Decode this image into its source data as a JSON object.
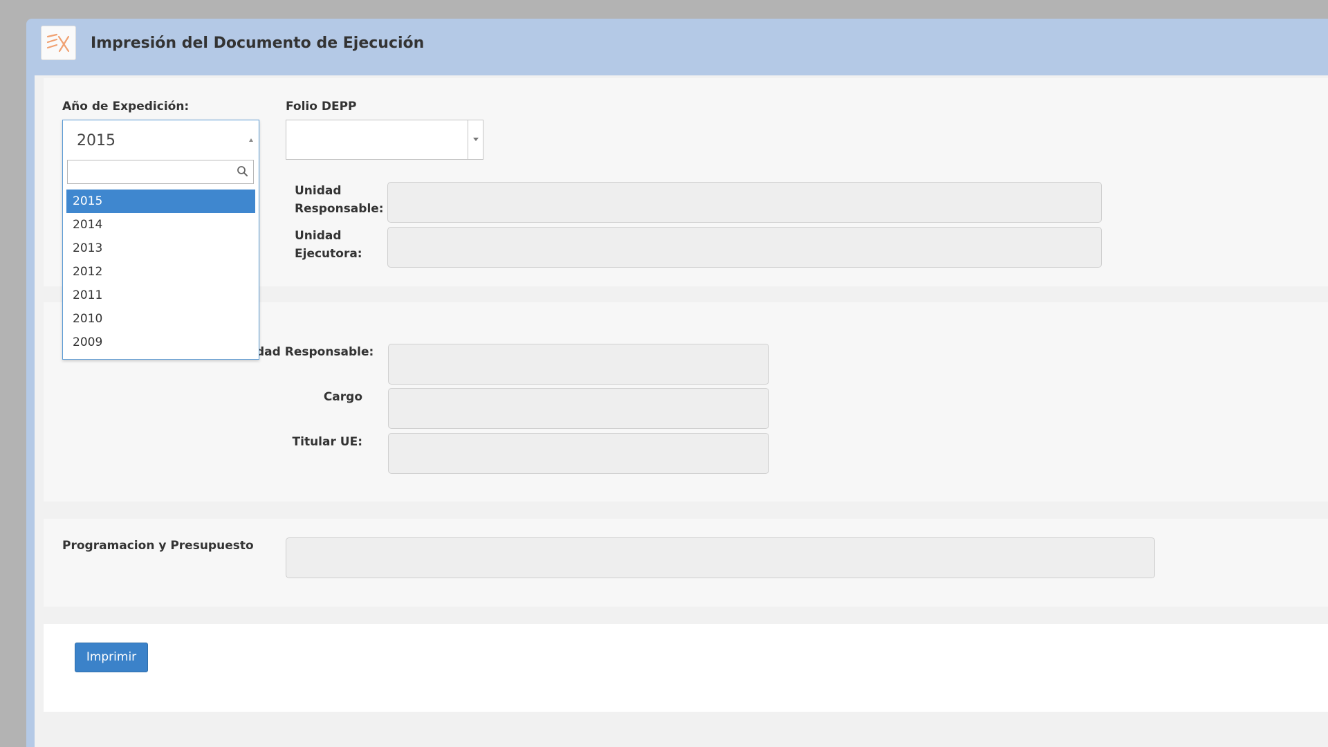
{
  "header": {
    "title": "Impresión del Documento de Ejecución",
    "logo_icon": "ex-logo-icon"
  },
  "form": {
    "anio_label": "Año de Expedición:",
    "anio_selected": "2015",
    "anio_options": [
      "2015",
      "2014",
      "2013",
      "2012",
      "2011",
      "2010",
      "2009"
    ],
    "folio_label": "Folio DEPP",
    "unidad_responsable_label_1": "Unidad",
    "unidad_responsable_label_2": "Responsable:",
    "unidad_ejecutora_label_1": "Unidad",
    "unidad_ejecutora_label_2": "Ejecutora:",
    "titular_ur_label_partial": "dad Responsable:",
    "cargo_label": "Cargo",
    "titular_ue_label": "Titular UE:",
    "programacion_label": "Programacion y Presupuesto"
  },
  "actions": {
    "imprimir_label": "Imprimir"
  },
  "colors": {
    "header_bg": "#b4c9e6",
    "accent": "#3f87cf",
    "button": "#3b82c9"
  }
}
